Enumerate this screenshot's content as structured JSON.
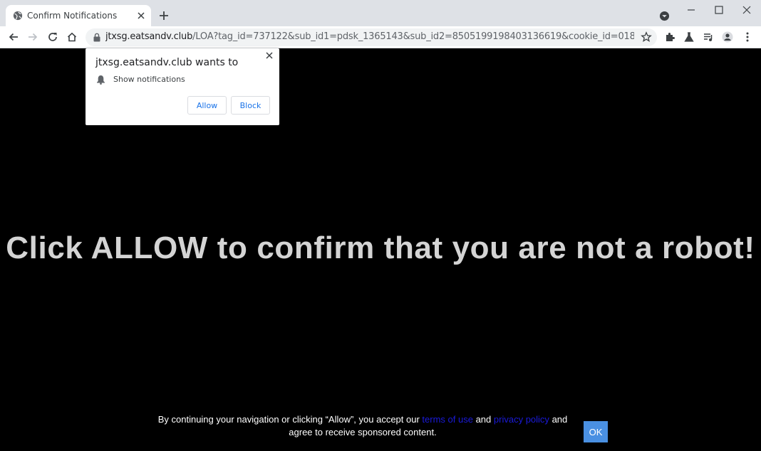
{
  "browser": {
    "tab_title": "Confirm Notifications",
    "url_host": "jtxsg.eatsandv.club",
    "url_path": "/LOA?tag_id=737122&sub_id1=pdsk_1365143&sub_id2=8505199198403136619&cookie_id=018a5350-672c-4b8f-82c1-..."
  },
  "popup": {
    "title": "jtxsg.eatsandv.club wants to",
    "permission": "Show notifications",
    "allow_label": "Allow",
    "block_label": "Block"
  },
  "page": {
    "headline": "Click ALLOW to confirm that you are not a robot!",
    "consent_prefix": "By continuing your navigation or clicking “Allow”, you accept our",
    "terms_link": "terms of use",
    "and_text": "and",
    "privacy_link": "privacy policy",
    "consent_suffix": "and agree to receive sponsored content.",
    "ok_label": "OK"
  },
  "colors": {
    "page_background": "#000000",
    "headline": "#d4d4d4",
    "link": "#1a1adb",
    "ok_button": "#4a90e2",
    "popup_button_text": "#1a73e8"
  },
  "icons": [
    "globe-icon",
    "close-icon",
    "plus-icon",
    "minimize-icon",
    "maximize-icon",
    "window-close-icon",
    "tab-search-icon",
    "back-arrow-icon",
    "forward-arrow-icon",
    "reload-icon",
    "home-icon",
    "lock-icon",
    "star-icon",
    "extensions-icon",
    "labs-flask-icon",
    "media-control-icon",
    "profile-icon",
    "menu-dots-icon",
    "bell-icon"
  ]
}
